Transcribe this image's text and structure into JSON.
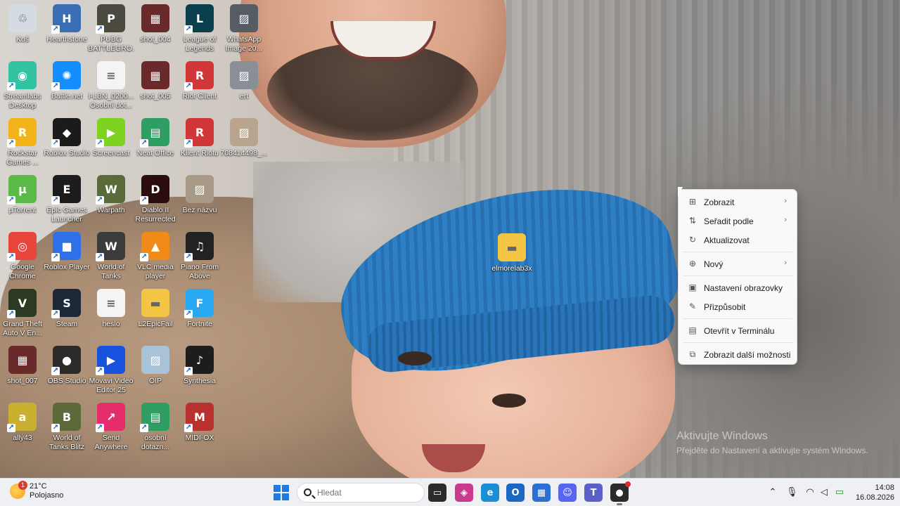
{
  "desktop": {
    "icons": [
      {
        "label": "Koš",
        "icon": "recycle-bin-icon",
        "color": "#d5dbe3"
      },
      {
        "label": "Hearthstone",
        "icon": "hearthstone-icon",
        "color": "#3b6fb5"
      },
      {
        "label": "PUBG BATTLEGRO...",
        "icon": "pubg-icon",
        "color": "#4a4a3f"
      },
      {
        "label": "shot_004",
        "icon": "image-icon",
        "color": "#6a2a2a"
      },
      {
        "label": "League of Legends",
        "icon": "league-icon",
        "color": "#0a3f4d"
      },
      {
        "label": "WhatsApp Image 20...",
        "icon": "photo-icon",
        "color": "#555c63"
      },
      {
        "label": "Streamlabs Desktop",
        "icon": "streamlabs-icon",
        "color": "#31c3a2"
      },
      {
        "label": "Battle.net",
        "icon": "battlenet-icon",
        "color": "#148eff"
      },
      {
        "label": "I-LBN_0200... Osobní dot...",
        "icon": "document-icon",
        "color": "#f4f4f4"
      },
      {
        "label": "shot_005",
        "icon": "image-icon",
        "color": "#6a2a2a"
      },
      {
        "label": "Riot Client",
        "icon": "riot-icon",
        "color": "#d13639"
      },
      {
        "label": "ert",
        "icon": "photo-icon",
        "color": "#8a8f96"
      },
      {
        "label": "Rockstar Games ...",
        "icon": "rockstar-icon",
        "color": "#f3b41b"
      },
      {
        "label": "Roblox Studio",
        "icon": "roblox-studio-icon",
        "color": "#1b1b1b"
      },
      {
        "label": "Screencast",
        "icon": "screencast-icon",
        "color": "#7ed321"
      },
      {
        "label": "Neat Office",
        "icon": "neat-office-icon",
        "color": "#2f9e63"
      },
      {
        "label": "Klient Riotu",
        "icon": "riot-icon",
        "color": "#d13639"
      },
      {
        "label": "708414498_...",
        "icon": "photo-icon",
        "color": "#b9a58e"
      },
      {
        "label": "µTorrent",
        "icon": "utorrent-icon",
        "color": "#5bb947"
      },
      {
        "label": "Epic Games Launcher",
        "icon": "epic-games-icon",
        "color": "#1c1c1c"
      },
      {
        "label": "Warpath",
        "icon": "warpath-icon",
        "color": "#5a6b3a"
      },
      {
        "label": "Diablo II Resurrected",
        "icon": "diablo-icon",
        "color": "#2a0c0c"
      },
      {
        "label": "Bez názvu",
        "icon": "photo-icon",
        "color": "#a99a88"
      },
      {
        "label": "Google Chrome",
        "icon": "chrome-icon",
        "color": "#e8453c"
      },
      {
        "label": "Roblox Player",
        "icon": "roblox-icon",
        "color": "#2f6fe8"
      },
      {
        "label": "World of Tanks",
        "icon": "world-of-tanks-icon",
        "color": "#3b3b3b"
      },
      {
        "label": "VLC media player",
        "icon": "vlc-icon",
        "color": "#f08a18"
      },
      {
        "label": "Piano From Above",
        "icon": "piano-icon",
        "color": "#222222"
      },
      {
        "label": "Grand Theft Auto V En...",
        "icon": "gta-icon",
        "color": "#2b3a22"
      },
      {
        "label": "Steam",
        "icon": "steam-icon",
        "color": "#1b2838"
      },
      {
        "label": "heslo",
        "icon": "document-icon",
        "color": "#f4f4f4"
      },
      {
        "label": "L2EpicFail",
        "icon": "folder-icon",
        "color": "#f4c542"
      },
      {
        "label": "Fortnite",
        "icon": "fortnite-icon",
        "color": "#28a8f0"
      },
      {
        "label": "shot_007",
        "icon": "image-icon",
        "color": "#6a2a2a"
      },
      {
        "label": "OBS Studio",
        "icon": "obs-icon",
        "color": "#2b2b2b"
      },
      {
        "label": "Movavi Video Editor 25",
        "icon": "movavi-icon",
        "color": "#1a52e0"
      },
      {
        "label": "OIP",
        "icon": "photo-icon",
        "color": "#a8c3d8"
      },
      {
        "label": "Synthesia",
        "icon": "synthesia-icon",
        "color": "#1d1d1d"
      },
      {
        "label": "ally43",
        "icon": "ally-icon",
        "color": "#c9b030"
      },
      {
        "label": "World of Tanks Blitz",
        "icon": "wot-blitz-icon",
        "color": "#5c6a3a"
      },
      {
        "label": "Send Anywhere",
        "icon": "send-anywhere-icon",
        "color": "#e52d6e"
      },
      {
        "label": "osobní dotazn...",
        "icon": "neat-office-icon",
        "color": "#2f9e63"
      },
      {
        "label": "MIDI-OX",
        "icon": "midi-ox-icon",
        "color": "#b8312f"
      },
      {
        "label": "elmorelab3x",
        "icon": "folder-icon",
        "color": "#f4c542"
      }
    ]
  },
  "context_menu": {
    "items": [
      {
        "label": "Zobrazit",
        "icon": "grid-icon",
        "has_submenu": true
      },
      {
        "label": "Seřadit podle",
        "icon": "sort-icon",
        "has_submenu": true
      },
      {
        "label": "Aktualizovat",
        "icon": "refresh-icon",
        "has_submenu": false
      },
      {
        "label": "Nový",
        "icon": "plus-circle-icon",
        "has_submenu": true
      },
      {
        "label": "Nastavení obrazovky",
        "icon": "display-settings-icon",
        "has_submenu": false
      },
      {
        "label": "Přizpůsobit",
        "icon": "brush-icon",
        "has_submenu": false
      },
      {
        "label": "Otevřít v Terminálu",
        "icon": "terminal-icon",
        "has_submenu": false
      },
      {
        "label": "Zobrazit další možnosti",
        "icon": "more-options-icon",
        "has_submenu": false
      }
    ]
  },
  "watermark": {
    "title": "Aktivujte Windows",
    "subtitle": "Přejděte do Nastavení a aktivujte systém Windows."
  },
  "taskbar": {
    "weather": {
      "temperature": "21°C",
      "condition": "Polojasno",
      "badge": "1"
    },
    "search_placeholder": "Hledat",
    "apps": [
      {
        "icon": "file-explorer-icon",
        "color": "#f6c445"
      },
      {
        "icon": "streamlabs-taskbar-icon",
        "color": "#c93a8d"
      },
      {
        "icon": "edge-icon",
        "color": "#1b8fd6"
      },
      {
        "icon": "outlook-icon",
        "color": "#1a67c4"
      },
      {
        "icon": "store-icon",
        "color": "#2a6fd4"
      },
      {
        "icon": "discord-icon",
        "color": "#5865f2"
      },
      {
        "icon": "teams-icon",
        "color": "#5b5fc7"
      },
      {
        "icon": "obs-taskbar-icon",
        "color": "#2b2b2b"
      }
    ],
    "tray": {
      "icons": [
        "chevron-up-icon",
        "microphone-icon",
        "wifi-icon",
        "volume-icon",
        "battery-icon"
      ]
    },
    "clock": {
      "time": "14:08",
      "date": "16.08.2026"
    }
  }
}
